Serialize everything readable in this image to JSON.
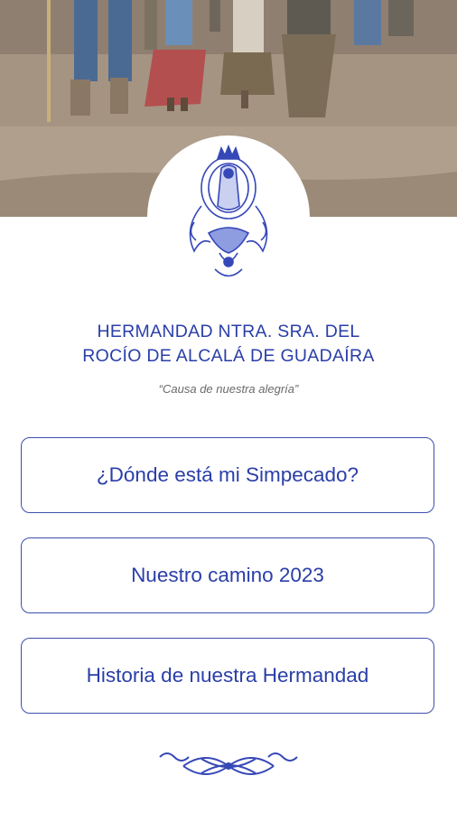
{
  "header": {
    "title_line1": "HERMANDAD NTRA. SRA. DEL",
    "title_line2": "ROCÍO DE ALCALÁ DE GUADAÍRA",
    "motto": "“Causa de nuestra alegría”"
  },
  "menu": {
    "items": [
      {
        "label": "¿Dónde está mi Simpecado?"
      },
      {
        "label": "Nuestro camino 2023"
      },
      {
        "label": "Historia de nuestra Hermandad"
      }
    ]
  },
  "colors": {
    "brand_blue": "#2a3ea8",
    "button_border": "#3d4fae",
    "motto_gray": "#6a6a6a"
  },
  "icons": {
    "emblem": "virgin-rocio-emblem-icon",
    "ornament": "flourish-ornament-icon"
  }
}
